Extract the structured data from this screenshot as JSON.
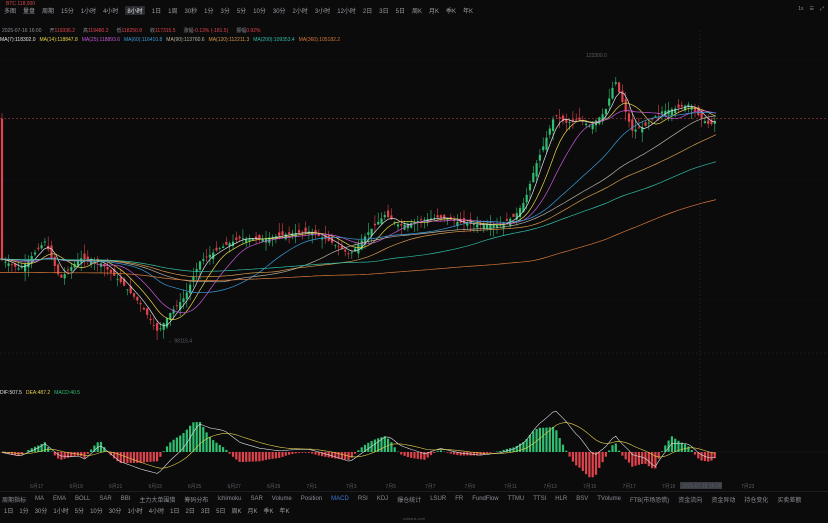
{
  "topbar": {
    "label": "BTC 118,000"
  },
  "toolbar": {
    "items": [
      "多图",
      "量盘",
      "周期",
      "15分",
      "1小时",
      "4小时",
      "8小时",
      "1日",
      "1周",
      "30秒",
      "1分",
      "3分",
      "5分",
      "10分",
      "30分",
      "2小时",
      "3小时",
      "12小时",
      "2日",
      "3日",
      "5日",
      "周K",
      "月K",
      "季K",
      "年K"
    ],
    "active_index": 6,
    "right": [
      "1x",
      "☰",
      "⤢"
    ]
  },
  "ohlc": {
    "date": "2025-07-16 16:00",
    "open_label": "开",
    "open": "119336.2",
    "high_label": "高",
    "high": "119480.2",
    "low_label": "低",
    "low": "118250.8",
    "close_label": "收",
    "close": "117315.5",
    "change_label": "涨幅",
    "change": "-0.13% (-181.5)",
    "amp_label": "振幅",
    "amp": "0.92%"
  },
  "ma": [
    {
      "label": "MA(7):118302.0",
      "color": "#e0e2e6"
    },
    {
      "label": "MA(14):118847.8",
      "color": "#e8d34a"
    },
    {
      "label": "MA(25):118893.6",
      "color": "#c658d8"
    },
    {
      "label": "MA(60):116410.8",
      "color": "#3a9cdb"
    },
    {
      "label": "MA(90):113760.6",
      "color": "#b8b2a0"
    },
    {
      "label": "MA(120):112211.3",
      "color": "#d69a4a"
    },
    {
      "label": "MA(200):109353.4",
      "color": "#2fbfa8"
    },
    {
      "label": "MA(360):105182.2",
      "color": "#d9783a"
    }
  ],
  "annotations": {
    "high": "123300.0",
    "low": "98115.4"
  },
  "xaxis": [
    "6月17",
    "6月19",
    "6月21",
    "6月23",
    "6月25",
    "6月27",
    "6月29",
    "7月1",
    "7月3",
    "7月5",
    "7月7",
    "7月9",
    "7月11",
    "7月13",
    "7月15",
    "7月17",
    "7月19",
    "7月21",
    "7月23"
  ],
  "crosshair_label": "2025-07-18 16:00",
  "macd_legend": [
    {
      "label": "DIF:507.5",
      "color": "#e0e2e6"
    },
    {
      "label": "DEA:487.2",
      "color": "#e8d34a"
    },
    {
      "label": "MACD:40.5",
      "color": "#2fbf71"
    }
  ],
  "indicator_tabs": [
    "周期指标",
    "MA",
    "EMA",
    "BOLL",
    "SAR",
    "BBI",
    "主力大单围猎",
    "筹码分布",
    "Ichimoku",
    "SAR",
    "Volume",
    "Position",
    "MACD",
    "RSI",
    "KDJ",
    "爆仓统计",
    "LSUR",
    "FR",
    "FundFlow",
    "TTMU",
    "TTSI",
    "HLR",
    "BSV",
    "TVolume",
    "FTB(市场恐慌)",
    "资金流向",
    "资金异动",
    "持仓变化",
    "买卖差额"
  ],
  "indicator_active": 12,
  "bottombar": [
    "1日",
    "1分",
    "30分",
    "1小时",
    "5分",
    "10分",
    "30分",
    "1小时",
    "4小时",
    "1日",
    "2日",
    "3日",
    "5日",
    "周K",
    "月K",
    "季K",
    "年K"
  ],
  "footer": "coinank.com",
  "colors": {
    "up": "#2fbf71",
    "down": "#e0434b",
    "bg": "#0b0b0c"
  }
}
